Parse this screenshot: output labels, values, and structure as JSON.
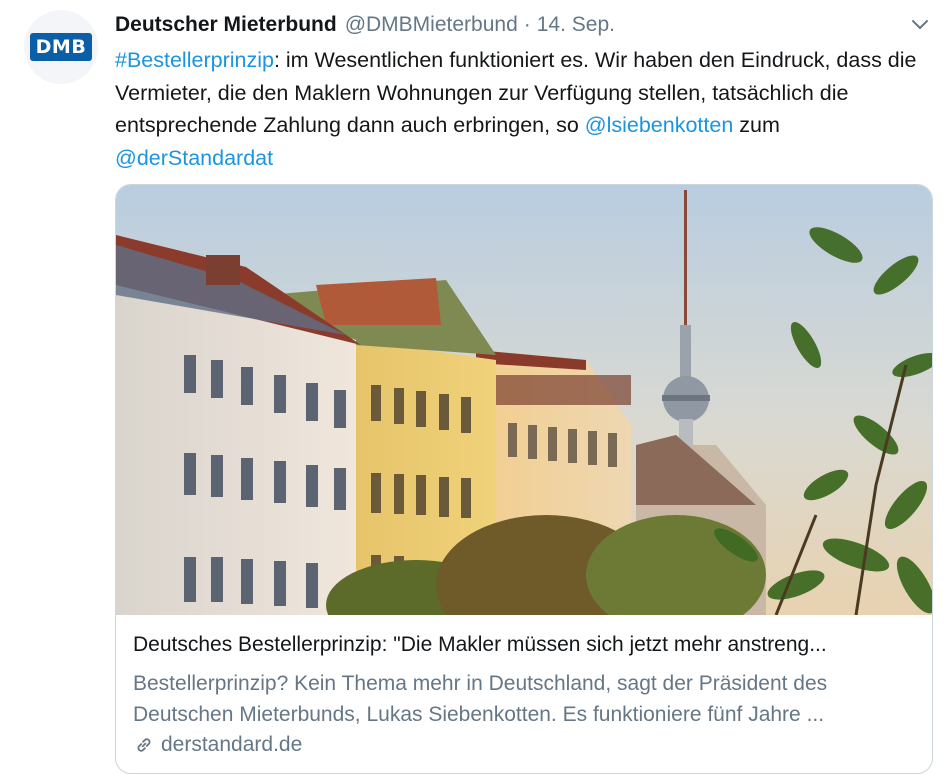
{
  "tweet": {
    "avatar_text": "DMB",
    "display_name": "Deutscher Mieterbund",
    "handle": "@DMBMieterbund",
    "separator": "·",
    "date": "14. Sep.",
    "text": {
      "hashtag": "#Bestellerprinzip",
      "part1": ": im Wesentlichen funktioniert es. Wir haben den Eindruck, dass die Vermieter, die den Maklern Wohnungen zur Verfügung stellen, tatsächlich die entsprechende Zahlung dann auch erbringen, so ",
      "mention1": "@lsiebenkotten",
      "part2": " zum ",
      "mention2": "@derStandardat"
    }
  },
  "card": {
    "title": "Deutsches Bestellerprinzip: \"Die Makler müssen sich jetzt mehr anstreng...",
    "description": "Bestellerprinzip? Kein Thema mehr in Deutschland, sagt der Präsident des Deutschen Mieterbunds, Lukas Siebenkotten. Es funktioniere fünf Jahre ...",
    "domain": "derstandard.de"
  },
  "colors": {
    "link": "#1b95e0",
    "secondary": "#657786",
    "text": "#14171a",
    "border": "#ccd6dd",
    "logo": "#0b5fa8"
  },
  "icons": [
    "chevron-down-icon",
    "link-icon"
  ]
}
